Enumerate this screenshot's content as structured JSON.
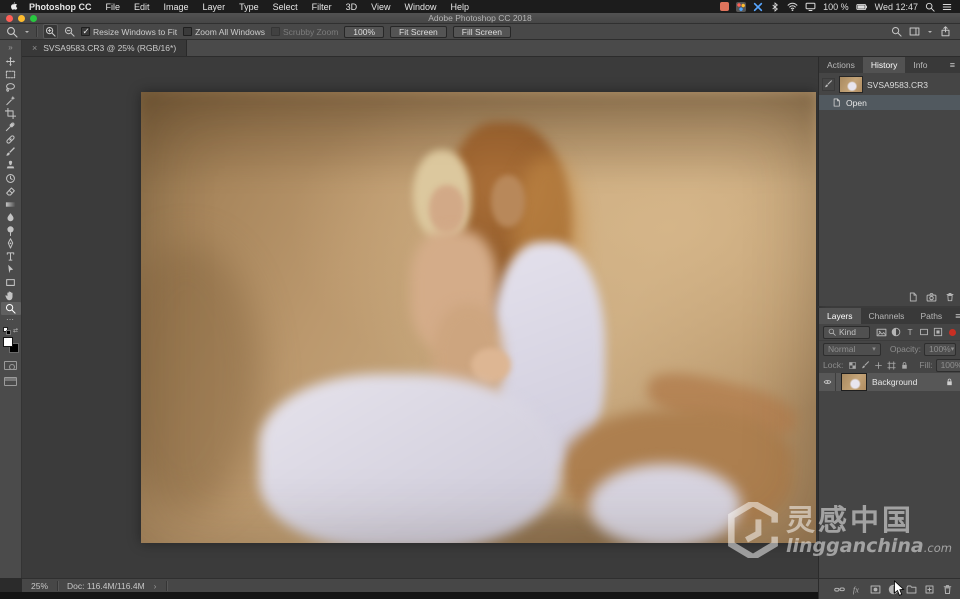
{
  "menu_bar": {
    "items": [
      "Photoshop CC",
      "File",
      "Edit",
      "Image",
      "Layer",
      "Type",
      "Select",
      "Filter",
      "3D",
      "View",
      "Window",
      "Help"
    ],
    "battery": "100 %",
    "clock": "Wed 12:47"
  },
  "title_bar": {
    "title": "Adobe Photoshop CC 2018"
  },
  "options_bar": {
    "resize_windows_label": "Resize Windows to Fit",
    "zoom_all_label": "Zoom All Windows",
    "scrubby_label": "Scrubby Zoom",
    "pct_button": "100%",
    "fit_button": "Fit Screen",
    "fill_button": "Fill Screen"
  },
  "document_tab": {
    "title": "SVSA9583.CR3 @ 25% (RGB/16*)",
    "close_glyph": "×"
  },
  "toolbar": {
    "tools": [
      "move",
      "rectangular-marquee",
      "lasso",
      "quick-selection",
      "crop",
      "eyedropper",
      "spot-healing-brush",
      "brush",
      "clone-stamp",
      "history-brush",
      "eraser",
      "gradient",
      "blur",
      "dodge",
      "pen",
      "type",
      "path-selection",
      "rectangle-shape",
      "hand",
      "zoom"
    ],
    "active_tool": "zoom"
  },
  "history_panel": {
    "tabs": [
      "Actions",
      "History",
      "Info"
    ],
    "active_tab": "History",
    "source_item": "SVSA9583.CR3",
    "states": [
      {
        "label": "Open",
        "selected": true
      }
    ]
  },
  "layers_panel": {
    "tabs": [
      "Layers",
      "Channels",
      "Paths"
    ],
    "active_tab": "Layers",
    "filter_kind_label": "Kind",
    "blend_mode": "Normal",
    "opacity_label": "Opacity:",
    "opacity_value": "100%",
    "lock_label": "Lock:",
    "fill_label": "Fill:",
    "fill_value": "100%",
    "layers": [
      {
        "name": "Background",
        "visible": true,
        "locked": true,
        "selected": true
      }
    ]
  },
  "status_bar": {
    "zoom_level": "25%",
    "doc_sizes": "Doc: 116.4M/116.4M",
    "expander": "›"
  },
  "watermark": {
    "cn_text": "灵感中国",
    "en_text": "lingganchina",
    "tld_text": ".com"
  },
  "colors": {
    "traffic_red": "#ff5f57",
    "traffic_yellow": "#febc2e",
    "traffic_green": "#28c840",
    "panel_bg": "#454545",
    "canvas_bg": "#3b3b3b",
    "selection_row": "#51595f",
    "filter_toggle_red": "#c92f23"
  }
}
